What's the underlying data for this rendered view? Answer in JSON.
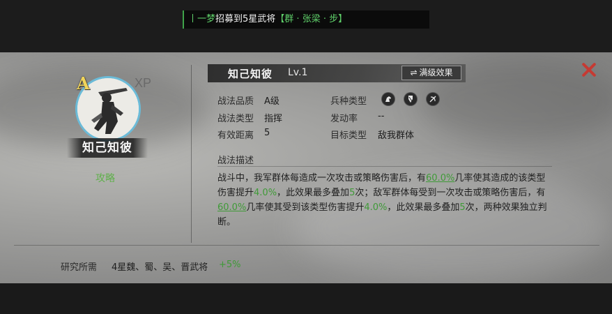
{
  "ticker": {
    "user": "丨一梦",
    "action": "招募到5星武将",
    "general": "【群 · 张梁 · 步】"
  },
  "hero": {
    "grade": "A",
    "xp_tag": "XP",
    "name": "知己知彼",
    "guide_label": "攻略"
  },
  "skill": {
    "name": "知己知彼",
    "level": "Lv.1",
    "max_button": "满级效果",
    "max_button_icon": "⇌"
  },
  "attributes": {
    "quality_label": "战法品质",
    "quality_value": "A级",
    "troop_label": "兵种类型",
    "troop_icons": [
      "cavalry-icon",
      "shield-icon",
      "bow-icon"
    ],
    "type_label": "战法类型",
    "type_value": "指挥",
    "rate_label": "发动率",
    "rate_value": "--",
    "range_label": "有效距离",
    "range_value": "5",
    "target_label": "目标类型",
    "target_value": "敌我群体"
  },
  "description": {
    "heading": "战法描述",
    "text": {
      "p1": "战斗中，我军群体每造成一次攻击或策略伤害后，有",
      "v1": "60.0%",
      "p2": "几率使其造成的该类型伤害提升",
      "v2": "4.0%",
      "p3": "，此效果最多叠加",
      "v3": "5",
      "p4": "次；敌军群体每受到一次攻击或策略伤害后，有",
      "v4": "60.0%",
      "p5": "几率使其受到该类型伤害提升",
      "v5": "4.0%",
      "p6": "，此效果最多叠加",
      "v6": "5",
      "p7": "次，两种效果独立判断。"
    }
  },
  "research": {
    "label": "研究所需",
    "value": "4星魏、蜀、吴、晋武将",
    "bonus": "+5%"
  },
  "colors": {
    "accent_green": "#3f9a37",
    "ticker_green": "#5fd06a",
    "close_red": "#c53a33",
    "portrait_ring": "#6bbbd8",
    "grade_gold": "#f0d45a"
  }
}
